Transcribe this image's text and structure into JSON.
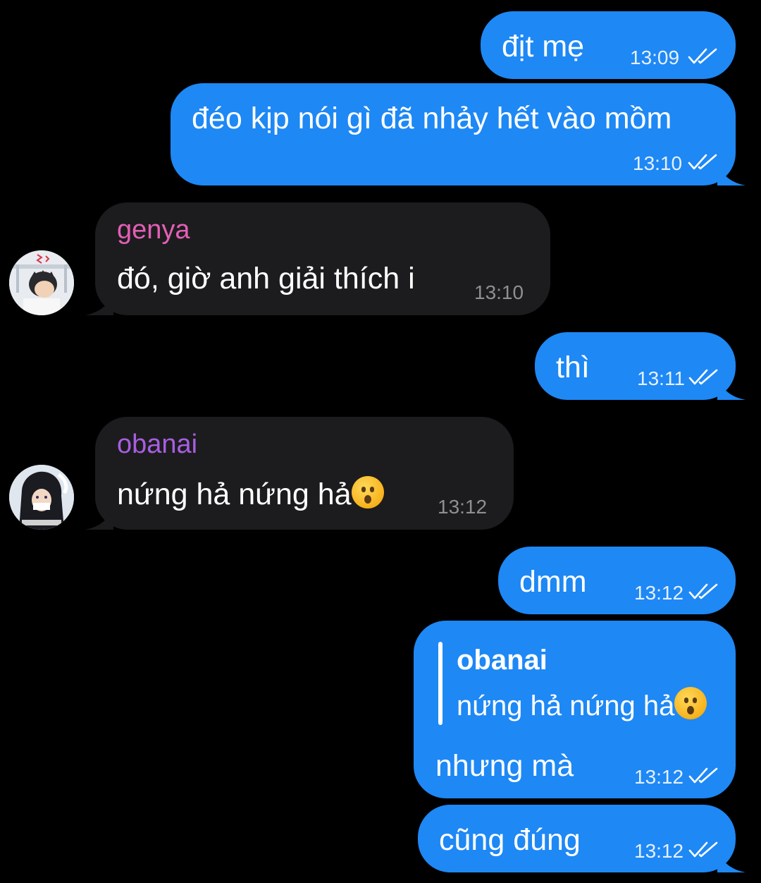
{
  "colors": {
    "background": "#000000",
    "outgoing_bubble": "#1e88f5",
    "incoming_bubble": "#1c1c1e",
    "genya_name": "#e35fb5",
    "obanai_name": "#a85ee0"
  },
  "messages": [
    {
      "direction": "outgoing",
      "text": "địt mẹ",
      "time": "13:09",
      "status": "read-double-check"
    },
    {
      "direction": "outgoing",
      "text": "đéo kịp nói gì đã nhảy hết vào mồm",
      "time": "13:10",
      "status": "read-double-check"
    },
    {
      "direction": "incoming",
      "sender": "genya",
      "text": "đó, giờ anh giải thích i",
      "time": "13:10"
    },
    {
      "direction": "outgoing",
      "text": "thì",
      "time": "13:11",
      "status": "read-double-check"
    },
    {
      "direction": "incoming",
      "sender": "obanai",
      "text": "nứng hả nứng hả",
      "emoji": "hushed-face-emoji",
      "time": "13:12"
    },
    {
      "direction": "outgoing",
      "text": "dmm",
      "time": "13:12",
      "status": "read-double-check"
    },
    {
      "direction": "outgoing",
      "reply_to": {
        "sender": "obanai",
        "text": "nứng hả nứng hả",
        "emoji": "hushed-face-emoji"
      },
      "text": "nhưng mà",
      "time": "13:12",
      "status": "read-double-check"
    },
    {
      "direction": "outgoing",
      "text": "cũng đúng",
      "time": "13:12",
      "status": "read-double-check"
    }
  ]
}
